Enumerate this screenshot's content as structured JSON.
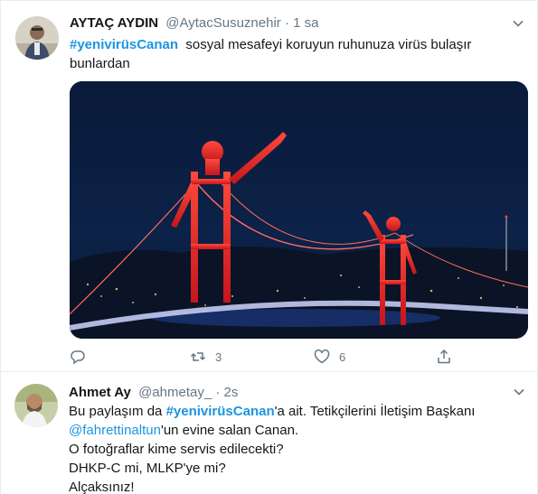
{
  "tweets": [
    {
      "display_name": "AYTAÇ AYDIN",
      "handle": "@AytacSusuznehir",
      "separator": "·",
      "time": "1 sa",
      "hashtag": "#yenivirüsCanan",
      "text_after_hashtag": "  sosyal mesafeyi koruyun ruhunuza virüs bulaşır bunlardan",
      "reply_count": "",
      "retweet_count": "3",
      "like_count": "6"
    },
    {
      "display_name": "Ahmet Ay",
      "handle": "@ahmetay_",
      "separator": "·",
      "time": "2s",
      "line1_prefix": "Bu paylaşım da ",
      "hashtag": "#yenivirüsCanan",
      "line1_suffix": "'a ait. Tetikçilerini İletişim Başkanı",
      "mention": "@fahrettinaltun",
      "line2_suffix": "'un evine salan Canan.",
      "line3": "O fotoğraflar kime servis edilecekti?",
      "line4": "DHKP-C mi, MLKP'ye mi?",
      "line5": "Alçaksınız!"
    }
  ],
  "icons": {
    "reply": "reply-icon",
    "retweet": "retweet-icon",
    "like": "heart-icon",
    "share": "share-icon",
    "more": "chevron-down-icon"
  },
  "colors": {
    "link": "#1b95e0",
    "secondary_text": "#657786",
    "bridge_red": "#e0242b"
  }
}
